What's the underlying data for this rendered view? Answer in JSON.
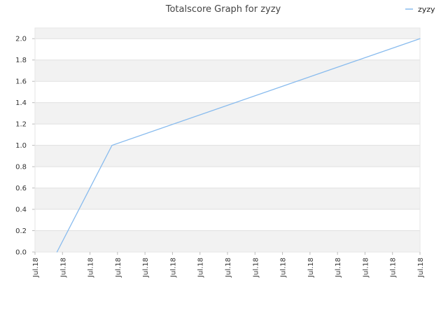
{
  "chart_data": {
    "type": "line",
    "title": "Totalscore Graph for zyzy",
    "xlabel": "",
    "ylabel": "",
    "ylim": [
      0,
      2.1
    ],
    "y_ticks": [
      0.0,
      0.2,
      0.4,
      0.6,
      0.8,
      1.0,
      1.2,
      1.4,
      1.6,
      1.8,
      2.0
    ],
    "x_tick_labels": [
      "Jul.18",
      "Jul.18",
      "Jul.18",
      "Jul.18",
      "Jul.18",
      "Jul.18",
      "Jul.18",
      "Jul.18",
      "Jul.18",
      "Jul.18",
      "Jul.18",
      "Jul.18",
      "Jul.18",
      "Jul.18",
      "Jul.18"
    ],
    "x_range": [
      0,
      14
    ],
    "grid": true,
    "legend_position": "top-right",
    "series": [
      {
        "name": "zyzy",
        "color": "#88bbee",
        "x": [
          0.8,
          2.8,
          14.0
        ],
        "y": [
          0.0,
          1.0,
          2.0
        ]
      }
    ]
  },
  "colors": {
    "band": "#f2f2f2",
    "gridline": "#e0e0e0",
    "line": "#88bbee"
  }
}
